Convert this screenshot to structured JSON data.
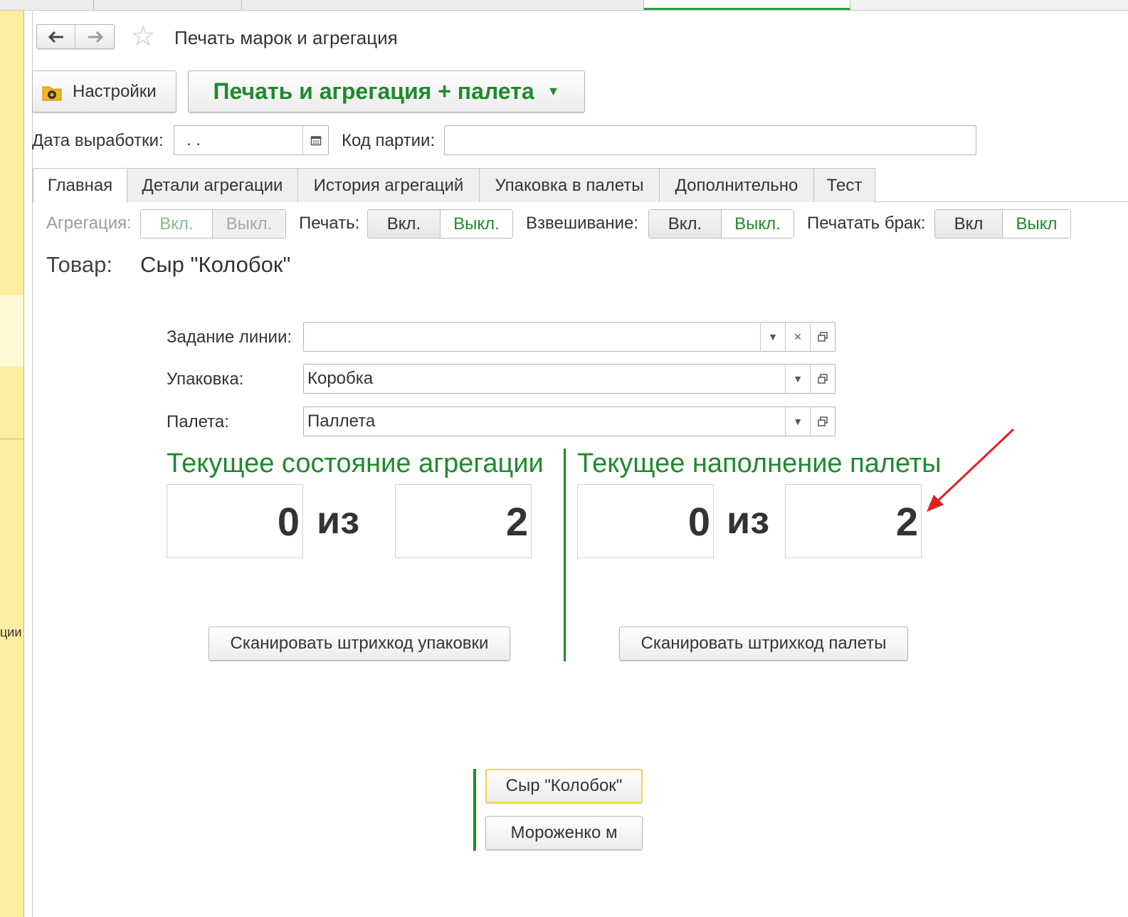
{
  "window": {
    "title": "Печать марок и агрегация"
  },
  "toolbar": {
    "settings_label": "Настройки",
    "main_action_label": "Печать и агрегация + палета"
  },
  "header_fields": {
    "date_label": "Дата выработки:",
    "date_value": " .  .",
    "batch_label": "Код партии:",
    "batch_value": ""
  },
  "tabs": [
    {
      "label": "Главная",
      "active": true
    },
    {
      "label": "Детали агрегации"
    },
    {
      "label": "История агрегаций"
    },
    {
      "label": "Упаковка в палеты"
    },
    {
      "label": "Дополнительно"
    },
    {
      "label": "Тест"
    }
  ],
  "toggles": {
    "aggregation": {
      "label": "Агрегация:",
      "on": "Вкл.",
      "off": "Выкл."
    },
    "print": {
      "label": "Печать:",
      "on": "Вкл.",
      "off": "Выкл."
    },
    "weighing": {
      "label": "Взвешивание:",
      "on": "Вкл.",
      "off": "Выкл."
    },
    "print_defect": {
      "label": "Печатать брак:",
      "on": "Вкл",
      "off": "Выкл"
    }
  },
  "product": {
    "label": "Товар:",
    "value": "Сыр \"Колобок\""
  },
  "fields": {
    "line_task": {
      "label": "Задание линии:",
      "value": ""
    },
    "packaging": {
      "label": "Упаковка:",
      "value": "Коробка"
    },
    "pallet": {
      "label": "Палета:",
      "value": "Паллета"
    }
  },
  "aggregation_status": {
    "title": "Текущее состояние агрегации",
    "current": "0",
    "of": "из",
    "total": "2",
    "scan_label": "Сканировать штрихкод упаковки"
  },
  "pallet_status": {
    "title": "Текущее наполнение палеты",
    "current": "0",
    "of": "из",
    "total": "2",
    "scan_label": "Сканировать штрихкод палеты"
  },
  "product_buttons": [
    "Сыр \"Колобок\"",
    "Мороженко м"
  ],
  "left_panel": {
    "label": "ции"
  },
  "icons": {
    "back": "arrow-left-icon",
    "forward": "arrow-right-icon",
    "favorite": "star-icon",
    "settings": "gear-folder-icon",
    "calendar": "calendar-icon",
    "dropdown": "chevron-down-icon",
    "clear": "close-icon",
    "open": "open-window-icon"
  },
  "colors": {
    "accent_green": "#1f8a2c",
    "left_panel_yellow": "#fbeea0",
    "annotation_red": "#e02020"
  }
}
